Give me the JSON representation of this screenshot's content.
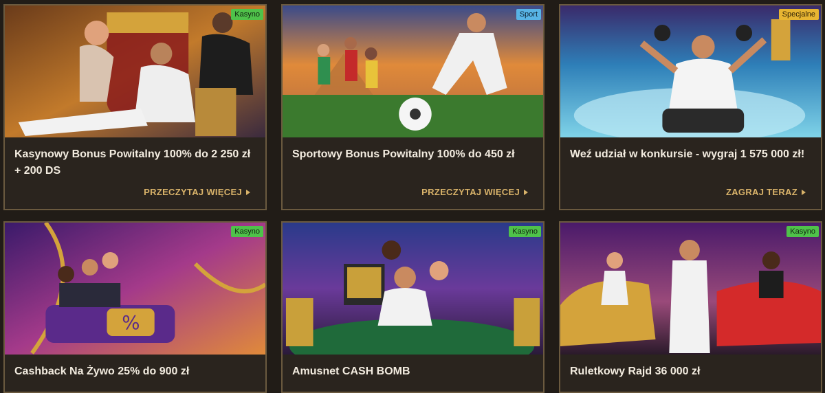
{
  "colors": {
    "card_bg": "#2a241e",
    "card_border": "#6b5a3f",
    "cta": "#d9b36a",
    "title": "#f3ece0",
    "badge_casino": "#4fc24a",
    "badge_sport": "#58b4e6",
    "badge_special": "#e7b532"
  },
  "cards": [
    {
      "badge": "Kasyno",
      "title": "Kasynowy Bonus Powitalny 100% do 2 250 zł + 200 DS",
      "cta": "PRZECZYTAJ WIĘCEJ"
    },
    {
      "badge": "Sport",
      "title": "Sportowy Bonus Powitalny 100% do 450 zł",
      "cta": "PRZECZYTAJ WIĘCEJ"
    },
    {
      "badge": "Specjalne",
      "title": "Weź udział w konkursie - wygraj 1 575 000 zł!",
      "cta": "ZAGRAJ TERAZ"
    },
    {
      "badge": "Kasyno",
      "title": "Cashback Na Żywo 25% do 900 zł"
    },
    {
      "badge": "Kasyno",
      "title": "Amusnet CASH BOMB"
    },
    {
      "badge": "Kasyno",
      "title": "Ruletkowy Rajd 36 000 zł"
    }
  ],
  "icons": [
    "arrow-right-icon"
  ]
}
